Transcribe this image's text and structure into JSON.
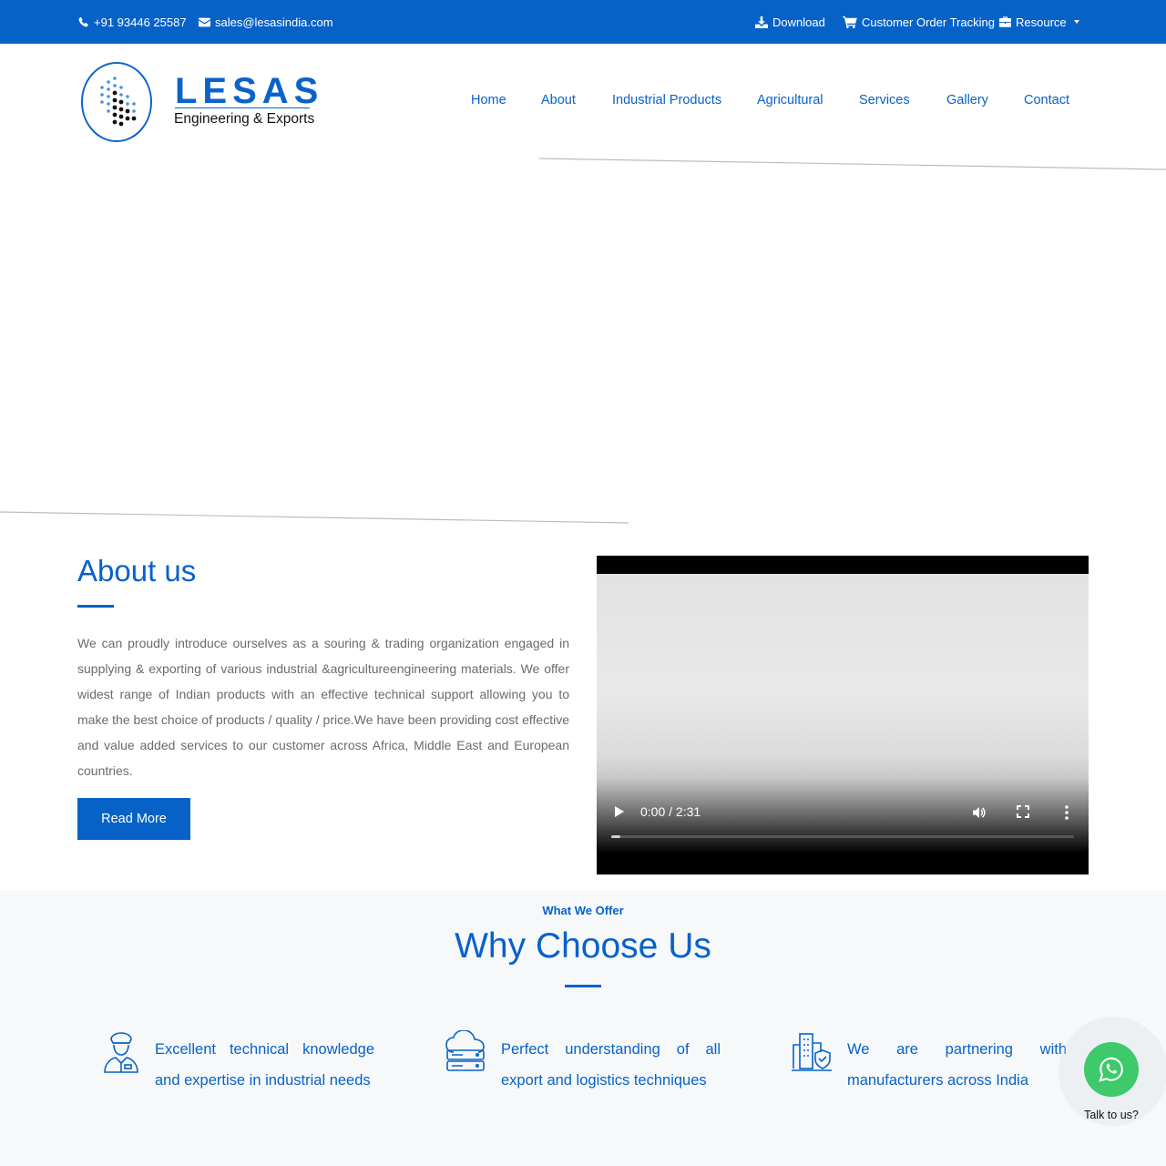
{
  "topbar": {
    "phone": "+91 93446 25587",
    "email": "sales@lesasindia.com",
    "download": "Download",
    "order_tracking": "Customer Order Tracking",
    "resource": "Resource"
  },
  "brand": {
    "name": "LESAS",
    "tagline": "Engineering & Exports"
  },
  "nav": {
    "items": [
      "Home",
      "About",
      "Industrial Products",
      "Agricultural",
      "Services",
      "Gallery",
      "Contact"
    ]
  },
  "about": {
    "title": "About us",
    "body": "We can proudly introduce ourselves as a souring & trading organization engaged in supplying & exporting of various industrial &agricultureengineering materials. We offer widest range of Indian products with an effective technical support allowing you to make the best choice of products / quality / price.We have been providing cost effective and value added services to our customer across Africa, Middle East and European countries.",
    "button": "Read More"
  },
  "video": {
    "time": "0:00 / 2:31",
    "progress": 0.02
  },
  "offer": {
    "eyebrow": "What We Offer",
    "title": "Why Choose Us",
    "features": [
      {
        "icon": "officer-icon",
        "text": "Excellent technical knowledge and expertise in industrial needs"
      },
      {
        "icon": "cloud-server-icon",
        "text": "Perfect understanding of all export and logistics techniques"
      },
      {
        "icon": "building-shield-icon",
        "text": "We are partnering with manufacturers across India"
      }
    ]
  },
  "whatsapp": {
    "label": "Talk to us?"
  },
  "colors": {
    "primary": "#0762c8",
    "whatsapp": "#3ec96b",
    "section_bg": "#f6f8fa"
  }
}
